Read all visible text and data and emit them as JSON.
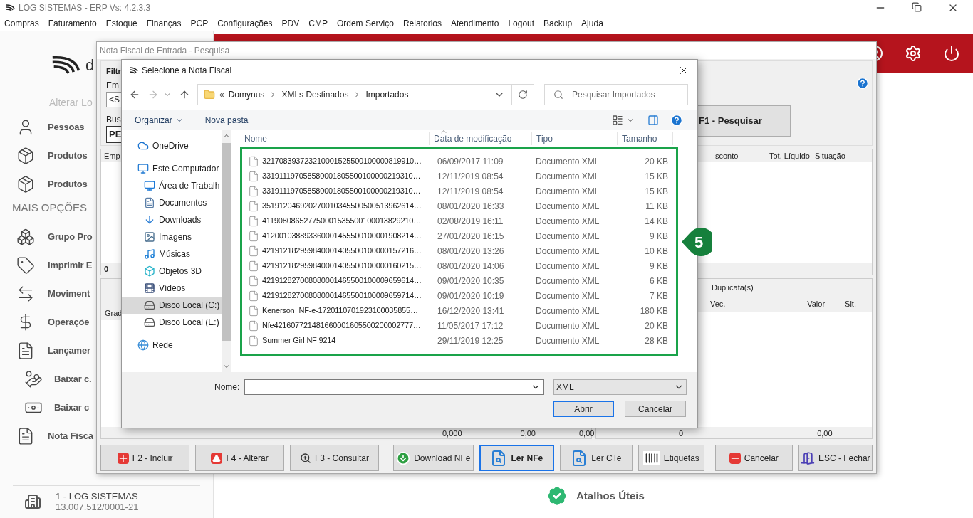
{
  "window": {
    "title": "LOG SISTEMAS - ERP Vs: 4.2.3.3"
  },
  "menu": [
    "Compras",
    "Faturamento",
    "Estoque",
    "Finanças",
    "PCP",
    "Configurações",
    "PDV",
    "CMP",
    "Ordem Serviço",
    "Relatorios",
    "Atendimento",
    "Logout",
    "Backup",
    "Ajuda"
  ],
  "sidebar": {
    "logo_text": "d",
    "link": "Alterar Lo",
    "items": [
      {
        "kind": "item",
        "label": "Pessoas"
      },
      {
        "kind": "item",
        "label": "Produtos"
      },
      {
        "kind": "item",
        "label": "Produtos"
      },
      {
        "kind": "section",
        "label": "MAIS OPÇÕES"
      },
      {
        "kind": "item",
        "label": "Grupo Pro"
      },
      {
        "kind": "item",
        "label": "Imprimir E"
      },
      {
        "kind": "item",
        "label": "Moviment"
      },
      {
        "kind": "item",
        "label": "Operaçõe"
      },
      {
        "kind": "item",
        "label": "Lançamer"
      },
      {
        "kind": "subitem",
        "label": "Baixar c."
      },
      {
        "kind": "subitem",
        "label": "Baixar c"
      },
      {
        "kind": "item",
        "label": "Nota Fisca"
      }
    ],
    "company": {
      "name": "1 - LOG SISTEMAS",
      "cnpj": "13.007.512/0001-21"
    }
  },
  "shortcuts_label": "Atalhos Úteis",
  "nf_window": {
    "title": "Nota Fiscal de Entrada - Pesquisa",
    "filter": {
      "title": "Filtr",
      "field_1_label": "Em",
      "field_1_value": "<S",
      "field_2_label": "Bus",
      "field_2_value": "PE"
    },
    "search_button": "F1 - Pesquisar",
    "table": {
      "columns": [
        "Emp",
        "sconto",
        "Tot. Líquido",
        "Situação"
      ],
      "footer": "0"
    },
    "lower": {
      "column_1": "Grad",
      "totals": [
        "0,000",
        "0,00",
        "0,00"
      ],
      "duplicates": {
        "title": "Duplicata(s)",
        "columns": [
          "Vec.",
          "Valor",
          "Sit."
        ],
        "totals": [
          "0",
          "0,00"
        ]
      }
    },
    "buttons": [
      {
        "label": "F2 - Incluir",
        "selected": false
      },
      {
        "label": "F4 - Alterar",
        "selected": false
      },
      {
        "label": "F3 - Consultar",
        "selected": false
      },
      {
        "label": "Download NFe",
        "selected": false
      },
      {
        "label": "Ler NFe",
        "selected": true
      },
      {
        "label": "Ler CTe",
        "selected": false
      },
      {
        "label": "Etiquetas",
        "selected": false
      },
      {
        "label": "Cancelar",
        "selected": false
      },
      {
        "label": "ESC - Fechar",
        "selected": false
      }
    ]
  },
  "dialog": {
    "title": "Selecione a Nota Fiscal",
    "path_overflow": "«",
    "path": [
      "Domynus",
      "XMLs Destinados",
      "Importados"
    ],
    "search_placeholder": "Pesquisar Importados",
    "toolbar": [
      "Organizar",
      "Nova pasta"
    ],
    "nav": [
      {
        "label": "OneDrive",
        "selected": false
      },
      {
        "label": "Este Computador",
        "selected": false,
        "children": [
          {
            "label": "Área de Trabalh",
            "selected": false
          },
          {
            "label": "Documentos",
            "selected": false
          },
          {
            "label": "Downloads",
            "selected": false
          },
          {
            "label": "Imagens",
            "selected": false
          },
          {
            "label": "Músicas",
            "selected": false
          },
          {
            "label": "Objetos 3D",
            "selected": false
          },
          {
            "label": "Vídeos",
            "selected": false
          },
          {
            "label": "Disco Local (C:)",
            "selected": true
          },
          {
            "label": "Disco Local (E:)",
            "selected": false
          }
        ]
      },
      {
        "label": "Rede",
        "selected": false
      }
    ],
    "columns": [
      "Nome",
      "Data de modificação",
      "Tipo",
      "Tamanho"
    ],
    "files": [
      {
        "name": "321708393723210001525500100000819910…",
        "date": "06/09/2017 11:09",
        "type": "Documento XML",
        "size": "20 KB"
      },
      {
        "name": "331911197058580001805500100000219310…",
        "date": "12/11/2019 08:54",
        "type": "Documento XML",
        "size": "15 KB"
      },
      {
        "name": "331911197058580001805500100000219310…",
        "date": "12/11/2019 08:54",
        "type": "Documento XML",
        "size": "15 KB"
      },
      {
        "name": "351912046920270010345500500513962614…",
        "date": "08/01/2020 16:33",
        "type": "Documento XML",
        "size": "11 KB"
      },
      {
        "name": "411908086527750001535500100013829210…",
        "date": "02/08/2019 16:11",
        "type": "Documento XML",
        "size": "14 KB"
      },
      {
        "name": "412001038893360001455500100001908214…",
        "date": "27/01/2020 16:15",
        "type": "Documento XML",
        "size": "9 KB"
      },
      {
        "name": "421912182959840001405500100000157216…",
        "date": "08/01/2020 13:26",
        "type": "Documento XML",
        "size": "10 KB"
      },
      {
        "name": "421912182959840001405500100000160215…",
        "date": "08/01/2020 14:06",
        "type": "Documento XML",
        "size": "9 KB"
      },
      {
        "name": "421912827008080001465500100009659614…",
        "date": "09/01/2020 10:35",
        "type": "Documento XML",
        "size": "6 KB"
      },
      {
        "name": "421912827008080001465500100009659714…",
        "date": "09/01/2020 10:19",
        "type": "Documento XML",
        "size": "7 KB"
      },
      {
        "name": "Kenerson_NF-e-1720110701923100035855…",
        "date": "16/12/2020 13:41",
        "type": "Documento XML",
        "size": "180 KB"
      },
      {
        "name": "Nfe421607721481660001605500200002777…",
        "date": "11/05/2017 17:12",
        "type": "Documento XML",
        "size": "20 KB"
      },
      {
        "name": "Summer Girl NF 9214",
        "date": "29/11/2019 12:25",
        "type": "Documento XML",
        "size": "28 KB"
      }
    ],
    "filename_label": "Nome:",
    "filter_value": "XML",
    "open_button": "Abrir",
    "cancel_button": "Cancelar"
  },
  "callout": "5"
}
